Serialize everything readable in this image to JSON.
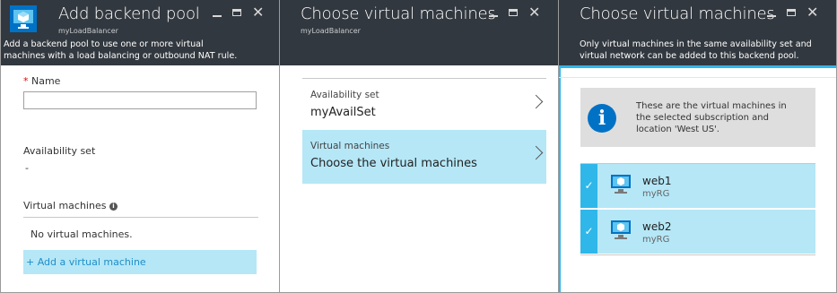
{
  "blade1": {
    "title": "Add backend pool",
    "subtitle": "myLoadBalancer",
    "description_line1": "Add a backend pool to use one or more virtual",
    "description_line2": "machines with a load balancing or outbound NAT rule.",
    "name_label": "Name",
    "required_mark": "*",
    "name_value": "",
    "availability_set_label": "Availability set",
    "availability_set_value": "-",
    "virtual_machines_label": "Virtual machines",
    "info_icon": "info-icon",
    "no_vms_text": "No virtual machines.",
    "add_vm_link": "+ Add a virtual machine"
  },
  "blade2": {
    "title": "Choose virtual machines",
    "subtitle": "myLoadBalancer",
    "items": [
      {
        "label": "Availability set",
        "value": "myAvailSet"
      },
      {
        "label": "Virtual machines",
        "value": "Choose the virtual machines"
      }
    ]
  },
  "blade3": {
    "title": "Choose virtual machines",
    "description_line1": "Only virtual machines in the same availability set and",
    "description_line2": "virtual network can be added to this backend pool.",
    "info_line1": "These are the virtual machines in",
    "info_line2": "the selected subscription and",
    "info_line3": "location 'West US'.",
    "vms": [
      {
        "name": "web1",
        "resource_group": "myRG",
        "selected": true
      },
      {
        "name": "web2",
        "resource_group": "myRG",
        "selected": true
      }
    ]
  },
  "colors": {
    "header_bg": "#32383f",
    "selected_bg": "#b5e7f7",
    "accent": "#2fb7ea",
    "azure_blue": "#0072c6"
  }
}
